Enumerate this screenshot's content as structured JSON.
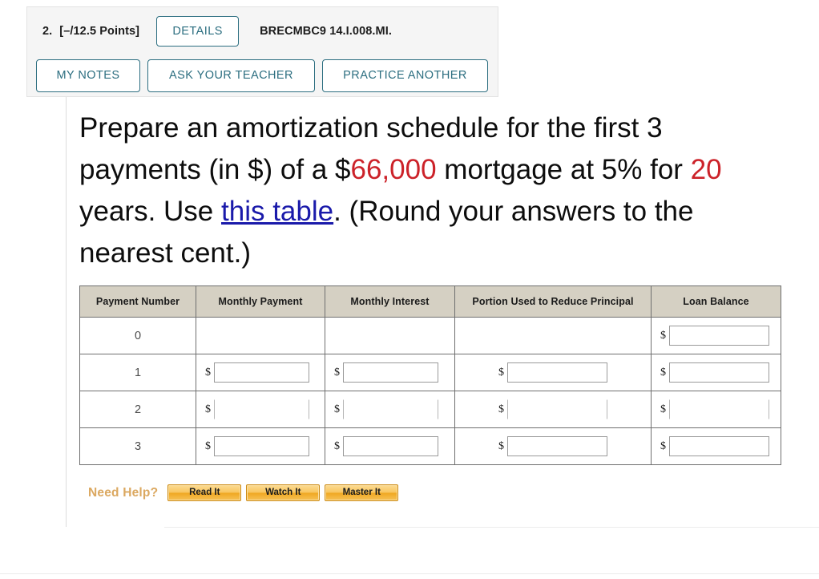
{
  "header": {
    "question_number": "2.",
    "points": "[–/12.5 Points]",
    "details_label": "DETAILS",
    "question_code": "BRECMBC9 14.I.008.MI.",
    "my_notes_label": "MY NOTES",
    "ask_teacher_label": "ASK YOUR TEACHER",
    "practice_another_label": "PRACTICE ANOTHER"
  },
  "question": {
    "line1": "Prepare an amortization schedule for the first 3",
    "line2_a": "payments (in $) of a $",
    "line2_principal": "66,000",
    "line2_b": " mortgage at 5% for ",
    "line2_years": "20",
    "line3_a": "years. Use ",
    "line3_link": "this table",
    "line3_b": ". (Round your answers to the",
    "line4": "nearest cent.)"
  },
  "table": {
    "columns": [
      "Payment Number",
      "Monthly Payment",
      "Monthly Interest",
      "Portion Used to Reduce Principal",
      "Loan Balance"
    ],
    "dollar_sign": "$",
    "rows": [
      {
        "payment_number": "0",
        "monthly_payment": "",
        "monthly_interest": "",
        "portion_principal": "",
        "loan_balance": ""
      },
      {
        "payment_number": "1",
        "monthly_payment": "",
        "monthly_interest": "",
        "portion_principal": "",
        "loan_balance": ""
      },
      {
        "payment_number": "2",
        "monthly_payment": "",
        "monthly_interest": "",
        "portion_principal": "",
        "loan_balance": ""
      },
      {
        "payment_number": "3",
        "monthly_payment": "",
        "monthly_interest": "",
        "portion_principal": "",
        "loan_balance": ""
      }
    ]
  },
  "need_help": {
    "label": "Need Help?",
    "read_it": "Read It",
    "watch_it": "Watch It",
    "master_it": "Master It"
  },
  "colors": {
    "accent_teal": "#2c6e80",
    "value_red": "#cc2229",
    "link_blue": "#1a1aaa",
    "table_header_tan": "#d5d0c3",
    "help_gold": "#f0a721",
    "need_help_label": "#dba860"
  }
}
